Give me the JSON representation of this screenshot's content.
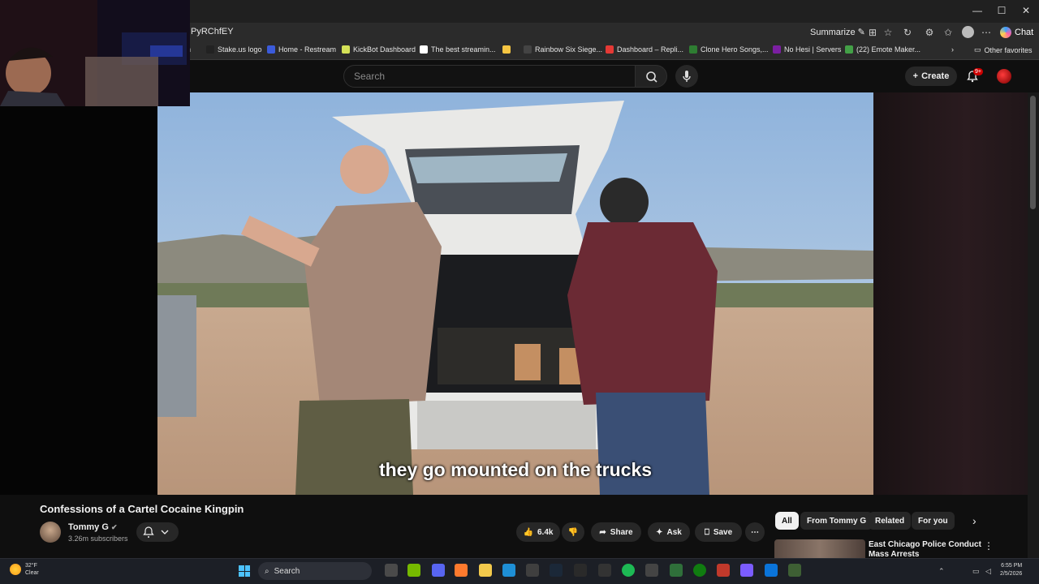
{
  "window": {
    "minimize": "—",
    "maximize": "☐",
    "close": "✕"
  },
  "address_bar": {
    "url_fragment": "PyRChfEY",
    "summarize_label": "Summarize",
    "chat_label": "Chat"
  },
  "bookmarks": [
    {
      "label": "n",
      "color": "#555555"
    },
    {
      "label": "Stake.us logo",
      "color": "#222222"
    },
    {
      "label": "Home - Restream",
      "color": "#3b5bdb"
    },
    {
      "label": "KickBot Dashboard",
      "color": "#d4e157"
    },
    {
      "label": "The best streamin...",
      "color": "#ffffff"
    },
    {
      "label": "",
      "color": "#f5c542"
    },
    {
      "label": "Rainbow Six Siege...",
      "color": "#444444"
    },
    {
      "label": "Dashboard – Repli...",
      "color": "#e53935"
    },
    {
      "label": "Clone Hero Songs,...",
      "color": "#2e7d32"
    },
    {
      "label": "No Hesi | Servers",
      "color": "#7b1fa2"
    },
    {
      "label": "(22) Emote Maker...",
      "color": "#43a047"
    }
  ],
  "other_favorites": "Other favorites",
  "header": {
    "search_placeholder": "Search",
    "create_label": "Create",
    "notifications_badge": "9+"
  },
  "video": {
    "caption": "they go mounted on the trucks"
  },
  "info": {
    "title": "Confessions of a Cartel Cocaine Kingpin",
    "channel": "Tommy G",
    "subscribers": "3.26m subscribers",
    "likes": "6.4k",
    "share": "Share",
    "ask": "Ask",
    "save": "Save"
  },
  "chips": [
    "All",
    "From Tommy G",
    "Related",
    "For you"
  ],
  "recommendation": {
    "title": "East Chicago Police Conduct Mass Arrests"
  },
  "taskbar": {
    "weather_temp": "32°F",
    "weather_desc": "Clear",
    "search_label": "Search",
    "time": "6:55 PM",
    "date": "2/5/2026"
  }
}
